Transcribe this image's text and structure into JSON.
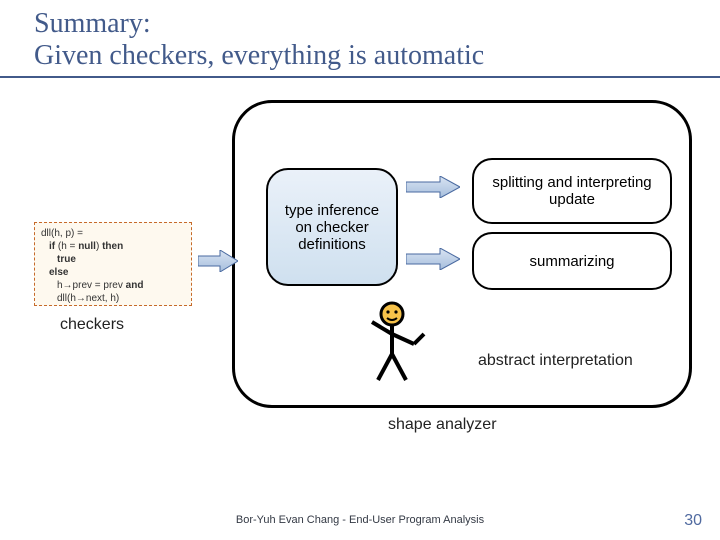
{
  "title_line1": "Summary:",
  "title_line2": "Given checkers, everything is automatic",
  "checker": {
    "l1a": "dll(h, p) =",
    "l2a": "if",
    "l2b": " (h = ",
    "l2c": "null",
    "l2d": ") ",
    "l2e": "then",
    "l3a": "true",
    "l4a": "else",
    "l5a": "h→prev = prev ",
    "l5b": "and",
    "l6a": "dll(h→next, h)"
  },
  "checkers_label": "checkers",
  "type_inference": "type inference on checker definitions",
  "splitting": "splitting and interpreting update",
  "summarizing": "summarizing",
  "abstract_interpretation": "abstract interpretation",
  "shape_analyzer": "shape analyzer",
  "footer": "Bor-Yuh Evan Chang - End-User Program Analysis",
  "pagenum": "30",
  "colors": {
    "title": "#425a8a",
    "checker_border": "#c66a2a"
  }
}
